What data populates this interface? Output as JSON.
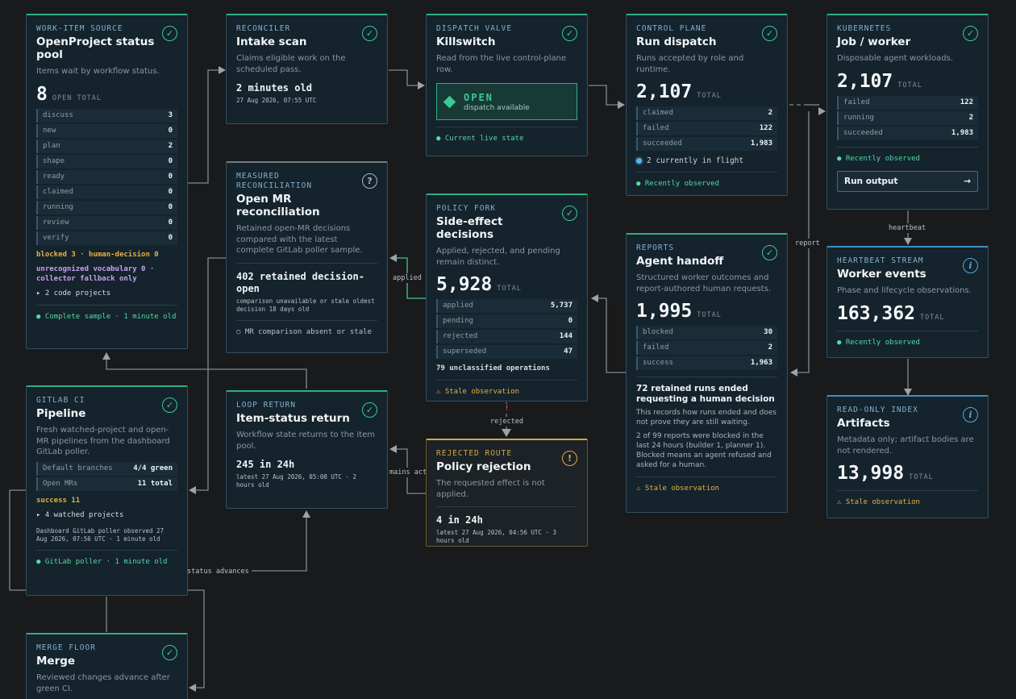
{
  "edges": {
    "heartbeat": "heartbeat",
    "report": "report",
    "applied": "applied",
    "rejected": "rejected",
    "remains_act": "mains act",
    "status_advances": "status advances",
    "reject_mark": "!"
  },
  "cards": {
    "source": {
      "kicker": "WORK-ITEM SOURCE",
      "title": "OpenProject status pool",
      "desc": "Items wait by workflow status.",
      "big": "8",
      "total": "OPEN TOTAL",
      "rows": [
        {
          "k": "discuss",
          "v": "3"
        },
        {
          "k": "new",
          "v": "0"
        },
        {
          "k": "plan",
          "v": "2"
        },
        {
          "k": "shape",
          "v": "0"
        },
        {
          "k": "ready",
          "v": "0"
        },
        {
          "k": "claimed",
          "v": "0"
        },
        {
          "k": "running",
          "v": "0"
        },
        {
          "k": "review",
          "v": "0"
        },
        {
          "k": "verify",
          "v": "0"
        }
      ],
      "blocked": "blocked 3 · human-decision 0",
      "unrecognized": "unrecognized vocabulary 0 · collector fallback only",
      "projects": "▸ 2 code projects",
      "footer": "● Complete sample · 1 minute old"
    },
    "reconciler": {
      "kicker": "RECONCILER",
      "title": "Intake scan",
      "desc": "Claims eligible work on the scheduled pass.",
      "strong": "2 minutes old",
      "small": "27 Aug 2026, 07:55 UTC"
    },
    "measured": {
      "kicker": "MEASURED RECONCILIATION",
      "title": "Open MR reconciliation",
      "desc": "Retained open-MR decisions compared with the latest complete GitLab poller sample.",
      "strong": "402 retained decision-open",
      "small": "comparison unavailable or stale oldest decision 18 days old",
      "footer": "○ MR comparison absent or stale"
    },
    "gitlab": {
      "kicker": "GITLAB CI",
      "title": "Pipeline",
      "desc": "Fresh watched-project and open-MR pipelines from the dashboard GitLab poller.",
      "rows": [
        {
          "k": "Default branches",
          "v": "4/4 green"
        },
        {
          "k": "Open MRs",
          "v": "11 total"
        }
      ],
      "success": "success 11",
      "projects": "▸ 4 watched projects",
      "observed": "Dashboard GitLab poller observed 27 Aug 2026, 07:56 UTC · 1 minute old",
      "footer": "● GitLab poller · 1 minute old"
    },
    "merge": {
      "kicker": "MERGE FLOOR",
      "title": "Merge",
      "desc": "Reviewed changes advance after green CI."
    },
    "loop": {
      "kicker": "LOOP RETURN",
      "title": "Item-status return",
      "desc": "Workflow state returns to the item pool.",
      "strong": "245 in 24h",
      "small": "latest 27 Aug 2026, 05:08 UTC · 2 hours old"
    },
    "valve": {
      "kicker": "DISPATCH VALVE",
      "title": "Killswitch",
      "desc": "Read from the live control-plane row.",
      "state": "OPEN",
      "state_sub": "dispatch available",
      "footer": "● Current live state"
    },
    "policy": {
      "kicker": "POLICY FORK",
      "title": "Side-effect decisions",
      "desc": "Applied, rejected, and pending remain distinct.",
      "big": "5,928",
      "total": "TOTAL",
      "rows": [
        {
          "k": "applied",
          "v": "5,737"
        },
        {
          "k": "pending",
          "v": "0"
        },
        {
          "k": "rejected",
          "v": "144"
        },
        {
          "k": "superseded",
          "v": "47"
        }
      ],
      "unclassified": "79 unclassified operations",
      "footer": "⚠ Stale observation"
    },
    "rejected": {
      "kicker": "REJECTED ROUTE",
      "title": "Policy rejection",
      "desc": "The requested effect is not applied.",
      "strong": "4 in 24h",
      "small": "latest 27 Aug 2026, 04:56 UTC · 3 hours old"
    },
    "control": {
      "kicker": "CONTROL PLANE",
      "title": "Run dispatch",
      "desc": "Runs accepted by role and runtime.",
      "big": "2,107",
      "total": "TOTAL",
      "rows": [
        {
          "k": "claimed",
          "v": "2"
        },
        {
          "k": "failed",
          "v": "122"
        },
        {
          "k": "succeeded",
          "v": "1,983"
        }
      ],
      "inflight": "2 currently in flight",
      "footer": "● Recently observed"
    },
    "reports": {
      "kicker": "REPORTS",
      "title": "Agent handoff",
      "desc": "Structured worker outcomes and report-authored human requests.",
      "big": "1,995",
      "total": "TOTAL",
      "rows": [
        {
          "k": "blocked",
          "v": "30"
        },
        {
          "k": "failed",
          "v": "2"
        },
        {
          "k": "success",
          "v": "1,963"
        }
      ],
      "retained": "72 retained runs ended requesting a human decision",
      "note1": "This records how runs ended and does not prove they are still waiting.",
      "note2": "2 of 99 reports were blocked in the last 24 hours (builder 1, planner 1). Blocked means an agent refused and asked for a human.",
      "footer": "⚠ Stale observation"
    },
    "k8s": {
      "kicker": "KUBERNETES",
      "title": "Job / worker",
      "desc": "Disposable agent workloads.",
      "big": "2,107",
      "total": "TOTAL",
      "rows": [
        {
          "k": "failed",
          "v": "122"
        },
        {
          "k": "running",
          "v": "2"
        },
        {
          "k": "succeeded",
          "v": "1,983"
        }
      ],
      "footer": "● Recently observed",
      "button": "Run output",
      "button_arrow": "→"
    },
    "heartbeat": {
      "kicker": "HEARTBEAT STREAM",
      "title": "Worker events",
      "desc": "Phase and lifecycle observations.",
      "big": "163,362",
      "total": "TOTAL",
      "footer": "● Recently observed"
    },
    "index": {
      "kicker": "READ-ONLY INDEX",
      "title": "Artifacts",
      "desc": "Metadata only; artifact bodies are not rendered.",
      "big": "13,998",
      "total": "TOTAL",
      "footer": "⚠ Stale observation"
    }
  },
  "icons": {
    "check": "check-icon",
    "question": "question-icon",
    "info": "info-icon",
    "warning": "warning-icon"
  },
  "colors": {
    "accent_green": "#3ec896",
    "info_blue": "#58a8d8",
    "warning_amber": "#e0ad3f",
    "background": "#191a1b",
    "card": "#14232c"
  }
}
